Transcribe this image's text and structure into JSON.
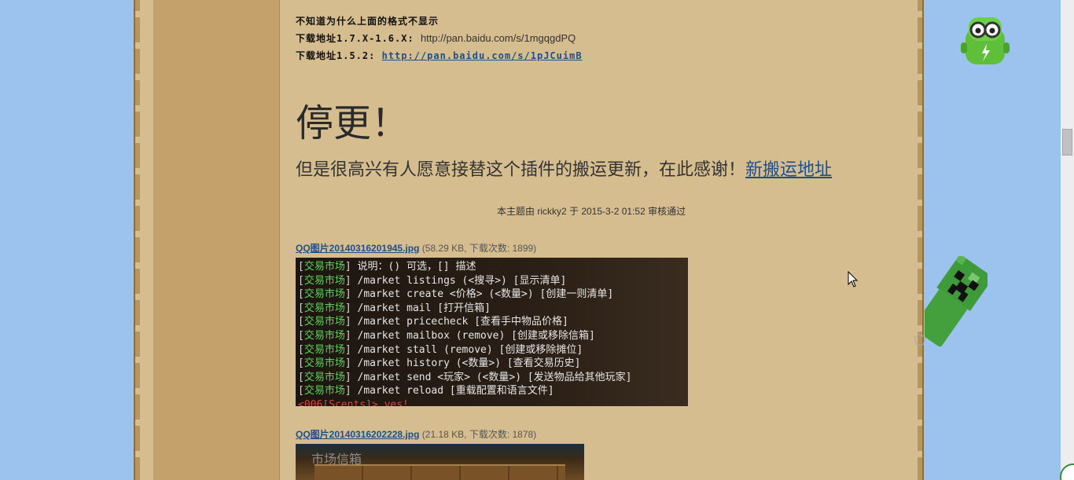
{
  "post": {
    "note_line": "不知道为什么上面的格式不显示",
    "download_17_label": "下载地址1.7.X-1.6.X:",
    "download_17_url": "http://pan.baidu.com/s/1mgqgdPQ",
    "download_15_label": "下载地址1.5.2:",
    "download_15_url": "http://pan.baidu.com/s/1pJCuimB",
    "stop_title": "停更！",
    "thanks_text": "但是很高兴有人愿意接替这个插件的搬运更新，在此感谢！",
    "new_address_link": "新搬运地址",
    "audit_text": "本主题由 rickky2 于 2015-3-2 01:52 审核通过"
  },
  "attachments": [
    {
      "filename": "QQ图片20140316201945.jpg",
      "meta": "(58.29 KB, 下载次数: 1899)"
    },
    {
      "filename": "QQ图片20140316202228.jpg",
      "meta": "(21.18 KB, 下载次数: 1878)"
    }
  ],
  "screenshot1": {
    "tag": "交易市场",
    "lines": [
      {
        "cmd": "说明：() 可选，[] 描述"
      },
      {
        "cmd": "/market listings (<搜寻>) [显示清单]"
      },
      {
        "cmd": "/market create <价格> (<数量>) [创建一则清单]"
      },
      {
        "cmd": "/market mail [打开信箱]"
      },
      {
        "cmd": "/market pricecheck [查看手中物品价格]"
      },
      {
        "cmd": "/market mailbox (remove) [创建或移除信箱]"
      },
      {
        "cmd": "/market stall (remove) [创建或移除摊位]"
      },
      {
        "cmd": "/market history (<数量>) [查看交易历史]"
      },
      {
        "cmd": "/market send <玩家> (<数量>) [发送物品给其他玩家]"
      },
      {
        "cmd": "/market reload [重载配置和语言文件]"
      }
    ],
    "last_line": "<006[Scents]> yes!"
  },
  "screenshot2": {
    "chest_title": "市场信箱"
  },
  "colors": {
    "page_bg": "#9cc3ee",
    "parchment": "#d6bd8f",
    "sidebar": "#c4a06b",
    "link": "#1d4f8f",
    "mc_tag_green": "#5dd35d"
  }
}
